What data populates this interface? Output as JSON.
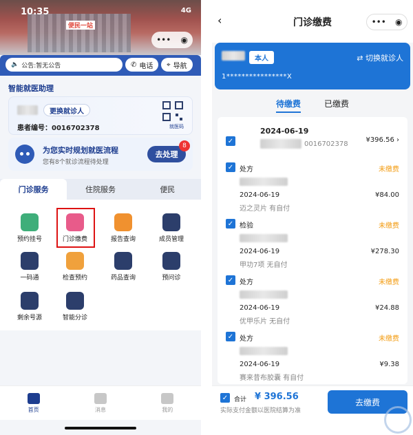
{
  "left": {
    "status_time": "10:35",
    "status_icons": "4G",
    "banner_sign": "便民一站",
    "notice": "公告:暂无公告",
    "phone_label": "电话",
    "nav_label": "导航",
    "assistant_title": "智能就医助理",
    "switch_patient": "更换就诊人",
    "patient_no": "患者编号：0016702378",
    "qr_label": "就医码",
    "flow_title": "为您实时规划就医流程",
    "flow_sub": "您有8个就诊流程待处理",
    "flow_button": "去处理",
    "flow_badge": "8",
    "tabs": [
      "门诊服务",
      "住院服务",
      "便民"
    ],
    "services": [
      {
        "label": "预约挂号",
        "color": "#3fae7a"
      },
      {
        "label": "门诊缴费",
        "color": "#e85b8a"
      },
      {
        "label": "报告查询",
        "color": "#f0912f"
      },
      {
        "label": "成员管理",
        "color": "#2c3e6b"
      },
      {
        "label": "一码通",
        "color": "#2c3e6b"
      },
      {
        "label": "检查预约",
        "color": "#f0a13c"
      },
      {
        "label": "药品查询",
        "color": "#2c3e6b"
      },
      {
        "label": "预问诊",
        "color": "#2c3e6b"
      },
      {
        "label": "剩余号源",
        "color": "#2c3e6b"
      },
      {
        "label": "智能分诊",
        "color": "#2c3e6b"
      }
    ],
    "bottom_nav": [
      "首页",
      "消息",
      "我的"
    ]
  },
  "right": {
    "title": "门诊缴费",
    "me_tag": "本人",
    "change_patient": "切换就诊人",
    "id_number": "1****************X",
    "tabs": [
      "待缴费",
      "已缴费"
    ],
    "group_date": "2024-06-19",
    "group_id_partial": "0016702378",
    "group_amount": "¥396.56",
    "items": [
      {
        "type": "处方",
        "status": "未缴费",
        "date": "2024-06-19",
        "name": "迈之灵片 有自付",
        "amount": "¥84.00"
      },
      {
        "type": "检验",
        "status": "未缴费",
        "date": "2024-06-19",
        "name": "甲功7项 无自付",
        "amount": "¥278.30"
      },
      {
        "type": "处方",
        "status": "未缴费",
        "date": "2024-06-19",
        "name": "优甲乐片 无自付",
        "amount": "¥24.88"
      },
      {
        "type": "处方",
        "status": "未缴费",
        "date": "2024-06-19",
        "name": "赛来昔布胶囊 有自付",
        "amount": "¥9.38"
      }
    ],
    "total_label": "合计",
    "total_currency": "¥",
    "total_value": "396.56",
    "note": "实际支付金额以医院结算为准",
    "pay_button": "去缴费"
  }
}
